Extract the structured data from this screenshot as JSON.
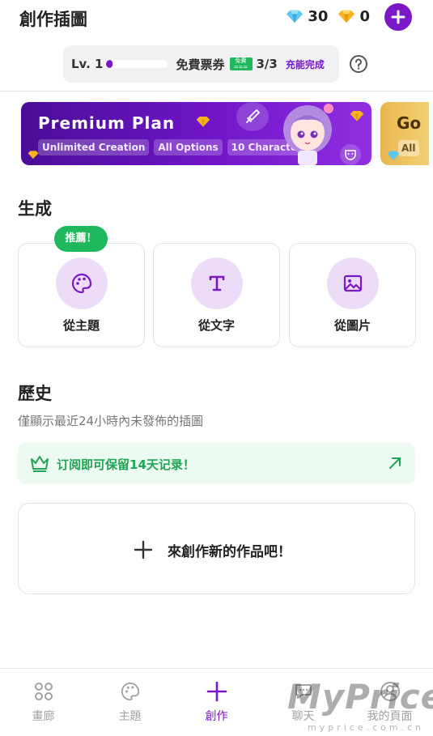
{
  "header": {
    "title": "創作插圖",
    "blue_gems": "30",
    "yellow_gems": "0"
  },
  "level": {
    "label": "Lv. 1",
    "progress": 0.05,
    "ticket_label": "免費票券",
    "ticket_badge": "免費 ===",
    "ticket_count": "3/3",
    "recharge": "充能完成"
  },
  "banner": {
    "title": "Premium Plan",
    "chips": [
      "Unlimited Creation",
      "All Options",
      "10 Characters"
    ],
    "next_title": "Go",
    "next_chip": "All"
  },
  "generate": {
    "title": "生成",
    "badge": "推薦！",
    "cards": [
      {
        "label": "從主題",
        "icon": "palette-icon"
      },
      {
        "label": "從文字",
        "icon": "text-icon"
      },
      {
        "label": "從圖片",
        "icon": "image-icon"
      }
    ]
  },
  "history": {
    "title": "歷史",
    "subtitle": "僅顯示最近24小時內未發佈的插圖",
    "notice": "订阅即可保留14天记录！",
    "create_label": "來創作新的作品吧！"
  },
  "nav": {
    "items": [
      {
        "label": "畫廊",
        "icon": "gallery-icon"
      },
      {
        "label": "主題",
        "icon": "palette-icon"
      },
      {
        "label": "創作",
        "icon": "plus-icon"
      },
      {
        "label": "聊天",
        "icon": "chat-icon"
      },
      {
        "label": "我的頁面",
        "icon": "profile-icon"
      }
    ],
    "active": "創作"
  },
  "watermark": {
    "text": "MyPrice",
    "sub": "myprice.com.cn"
  },
  "colors": {
    "accent": "#7a17c7",
    "green": "#1fb85c",
    "icon_bg": "#eddcf8"
  }
}
